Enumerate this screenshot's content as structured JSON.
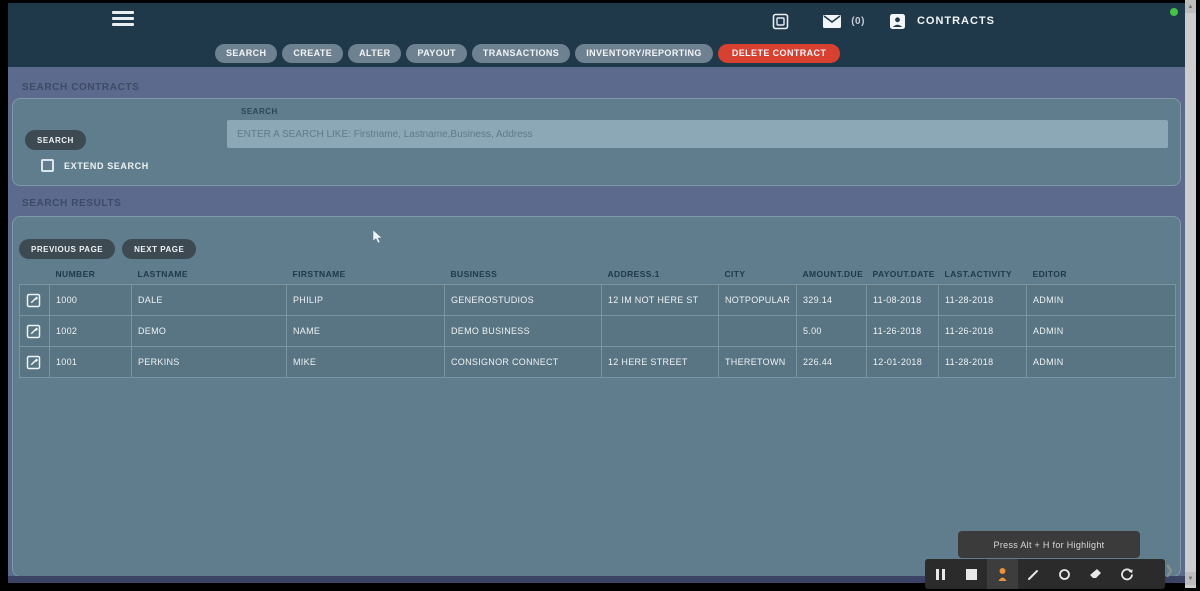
{
  "navbar": {
    "mail_count": "(0)",
    "title": "CONTRACTS"
  },
  "nav_tabs": [
    {
      "label": "SEARCH",
      "variant": "default"
    },
    {
      "label": "CREATE",
      "variant": "default"
    },
    {
      "label": "ALTER",
      "variant": "default"
    },
    {
      "label": "PAYOUT",
      "variant": "default"
    },
    {
      "label": "TRANSACTIONS",
      "variant": "default"
    },
    {
      "label": "INVENTORY/REPORTING",
      "variant": "default"
    },
    {
      "label": "DELETE CONTRACT",
      "variant": "danger"
    }
  ],
  "search_section": {
    "title": "SEARCH CONTRACTS",
    "search_button": "SEARCH",
    "input_label": "SEARCH",
    "input_placeholder": "ENTER A SEARCH LIKE: Firstname, Lastname,Business, Address",
    "extend_search_label": "EXTEND SEARCH"
  },
  "results_section": {
    "title": "SEARCH RESULTS",
    "previous_button": "PREVIOUS PAGE",
    "next_button": "NEXT PAGE",
    "table": {
      "columns": [
        "NUMBER",
        "LASTNAME",
        "FIRSTNAME",
        "BUSINESS",
        "ADDRESS.1",
        "CITY",
        "AMOUNT.DUE",
        "PAYOUT.DATE",
        "LAST.ACTIVITY",
        "EDITOR"
      ],
      "rows": [
        [
          "1000",
          "DALE",
          "PHILIP",
          "GENEROSTUDIOS",
          "12 IM NOT HERE ST",
          "NOTPOPULAR",
          "329.14",
          "11-08-2018",
          "11-28-2018",
          "ADMIN"
        ],
        [
          "1002",
          "DEMO",
          "NAME",
          "DEMO BUSINESS",
          "",
          "",
          "5.00",
          "11-26-2018",
          "11-26-2018",
          "ADMIN"
        ],
        [
          "1001",
          "PERKINS",
          "MIKE",
          "CONSIGNOR CONNECT",
          "12 HERE STREET",
          "THERETOWN",
          "226.44",
          "12-01-2018",
          "11-28-2018",
          "ADMIN"
        ]
      ]
    }
  },
  "recorder": {
    "tooltip": "Press Alt + H for Highlight"
  },
  "colors": {
    "navbar": "#20394a",
    "page_bg": "#5c6a8e",
    "panel_bg": "#5f7d8d",
    "row_bg": "#597482",
    "danger": "#d8402f",
    "accent_orange": "#e8923a",
    "green_status": "#45c349"
  }
}
